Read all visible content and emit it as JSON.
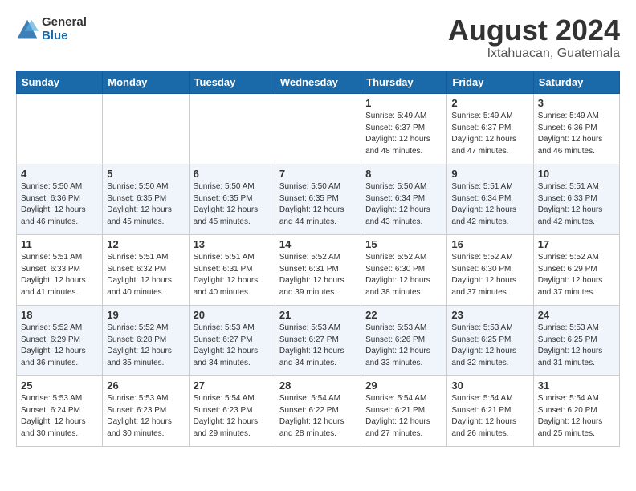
{
  "header": {
    "logo_general": "General",
    "logo_blue": "Blue",
    "month_year": "August 2024",
    "location": "Ixtahuacan, Guatemala"
  },
  "days_of_week": [
    "Sunday",
    "Monday",
    "Tuesday",
    "Wednesday",
    "Thursday",
    "Friday",
    "Saturday"
  ],
  "weeks": [
    [
      {
        "day": "",
        "info": ""
      },
      {
        "day": "",
        "info": ""
      },
      {
        "day": "",
        "info": ""
      },
      {
        "day": "",
        "info": ""
      },
      {
        "day": "1",
        "info": "Sunrise: 5:49 AM\nSunset: 6:37 PM\nDaylight: 12 hours\nand 48 minutes."
      },
      {
        "day": "2",
        "info": "Sunrise: 5:49 AM\nSunset: 6:37 PM\nDaylight: 12 hours\nand 47 minutes."
      },
      {
        "day": "3",
        "info": "Sunrise: 5:49 AM\nSunset: 6:36 PM\nDaylight: 12 hours\nand 46 minutes."
      }
    ],
    [
      {
        "day": "4",
        "info": "Sunrise: 5:50 AM\nSunset: 6:36 PM\nDaylight: 12 hours\nand 46 minutes."
      },
      {
        "day": "5",
        "info": "Sunrise: 5:50 AM\nSunset: 6:35 PM\nDaylight: 12 hours\nand 45 minutes."
      },
      {
        "day": "6",
        "info": "Sunrise: 5:50 AM\nSunset: 6:35 PM\nDaylight: 12 hours\nand 45 minutes."
      },
      {
        "day": "7",
        "info": "Sunrise: 5:50 AM\nSunset: 6:35 PM\nDaylight: 12 hours\nand 44 minutes."
      },
      {
        "day": "8",
        "info": "Sunrise: 5:50 AM\nSunset: 6:34 PM\nDaylight: 12 hours\nand 43 minutes."
      },
      {
        "day": "9",
        "info": "Sunrise: 5:51 AM\nSunset: 6:34 PM\nDaylight: 12 hours\nand 42 minutes."
      },
      {
        "day": "10",
        "info": "Sunrise: 5:51 AM\nSunset: 6:33 PM\nDaylight: 12 hours\nand 42 minutes."
      }
    ],
    [
      {
        "day": "11",
        "info": "Sunrise: 5:51 AM\nSunset: 6:33 PM\nDaylight: 12 hours\nand 41 minutes."
      },
      {
        "day": "12",
        "info": "Sunrise: 5:51 AM\nSunset: 6:32 PM\nDaylight: 12 hours\nand 40 minutes."
      },
      {
        "day": "13",
        "info": "Sunrise: 5:51 AM\nSunset: 6:31 PM\nDaylight: 12 hours\nand 40 minutes."
      },
      {
        "day": "14",
        "info": "Sunrise: 5:52 AM\nSunset: 6:31 PM\nDaylight: 12 hours\nand 39 minutes."
      },
      {
        "day": "15",
        "info": "Sunrise: 5:52 AM\nSunset: 6:30 PM\nDaylight: 12 hours\nand 38 minutes."
      },
      {
        "day": "16",
        "info": "Sunrise: 5:52 AM\nSunset: 6:30 PM\nDaylight: 12 hours\nand 37 minutes."
      },
      {
        "day": "17",
        "info": "Sunrise: 5:52 AM\nSunset: 6:29 PM\nDaylight: 12 hours\nand 37 minutes."
      }
    ],
    [
      {
        "day": "18",
        "info": "Sunrise: 5:52 AM\nSunset: 6:29 PM\nDaylight: 12 hours\nand 36 minutes."
      },
      {
        "day": "19",
        "info": "Sunrise: 5:52 AM\nSunset: 6:28 PM\nDaylight: 12 hours\nand 35 minutes."
      },
      {
        "day": "20",
        "info": "Sunrise: 5:53 AM\nSunset: 6:27 PM\nDaylight: 12 hours\nand 34 minutes."
      },
      {
        "day": "21",
        "info": "Sunrise: 5:53 AM\nSunset: 6:27 PM\nDaylight: 12 hours\nand 34 minutes."
      },
      {
        "day": "22",
        "info": "Sunrise: 5:53 AM\nSunset: 6:26 PM\nDaylight: 12 hours\nand 33 minutes."
      },
      {
        "day": "23",
        "info": "Sunrise: 5:53 AM\nSunset: 6:25 PM\nDaylight: 12 hours\nand 32 minutes."
      },
      {
        "day": "24",
        "info": "Sunrise: 5:53 AM\nSunset: 6:25 PM\nDaylight: 12 hours\nand 31 minutes."
      }
    ],
    [
      {
        "day": "25",
        "info": "Sunrise: 5:53 AM\nSunset: 6:24 PM\nDaylight: 12 hours\nand 30 minutes."
      },
      {
        "day": "26",
        "info": "Sunrise: 5:53 AM\nSunset: 6:23 PM\nDaylight: 12 hours\nand 30 minutes."
      },
      {
        "day": "27",
        "info": "Sunrise: 5:54 AM\nSunset: 6:23 PM\nDaylight: 12 hours\nand 29 minutes."
      },
      {
        "day": "28",
        "info": "Sunrise: 5:54 AM\nSunset: 6:22 PM\nDaylight: 12 hours\nand 28 minutes."
      },
      {
        "day": "29",
        "info": "Sunrise: 5:54 AM\nSunset: 6:21 PM\nDaylight: 12 hours\nand 27 minutes."
      },
      {
        "day": "30",
        "info": "Sunrise: 5:54 AM\nSunset: 6:21 PM\nDaylight: 12 hours\nand 26 minutes."
      },
      {
        "day": "31",
        "info": "Sunrise: 5:54 AM\nSunset: 6:20 PM\nDaylight: 12 hours\nand 25 minutes."
      }
    ]
  ]
}
